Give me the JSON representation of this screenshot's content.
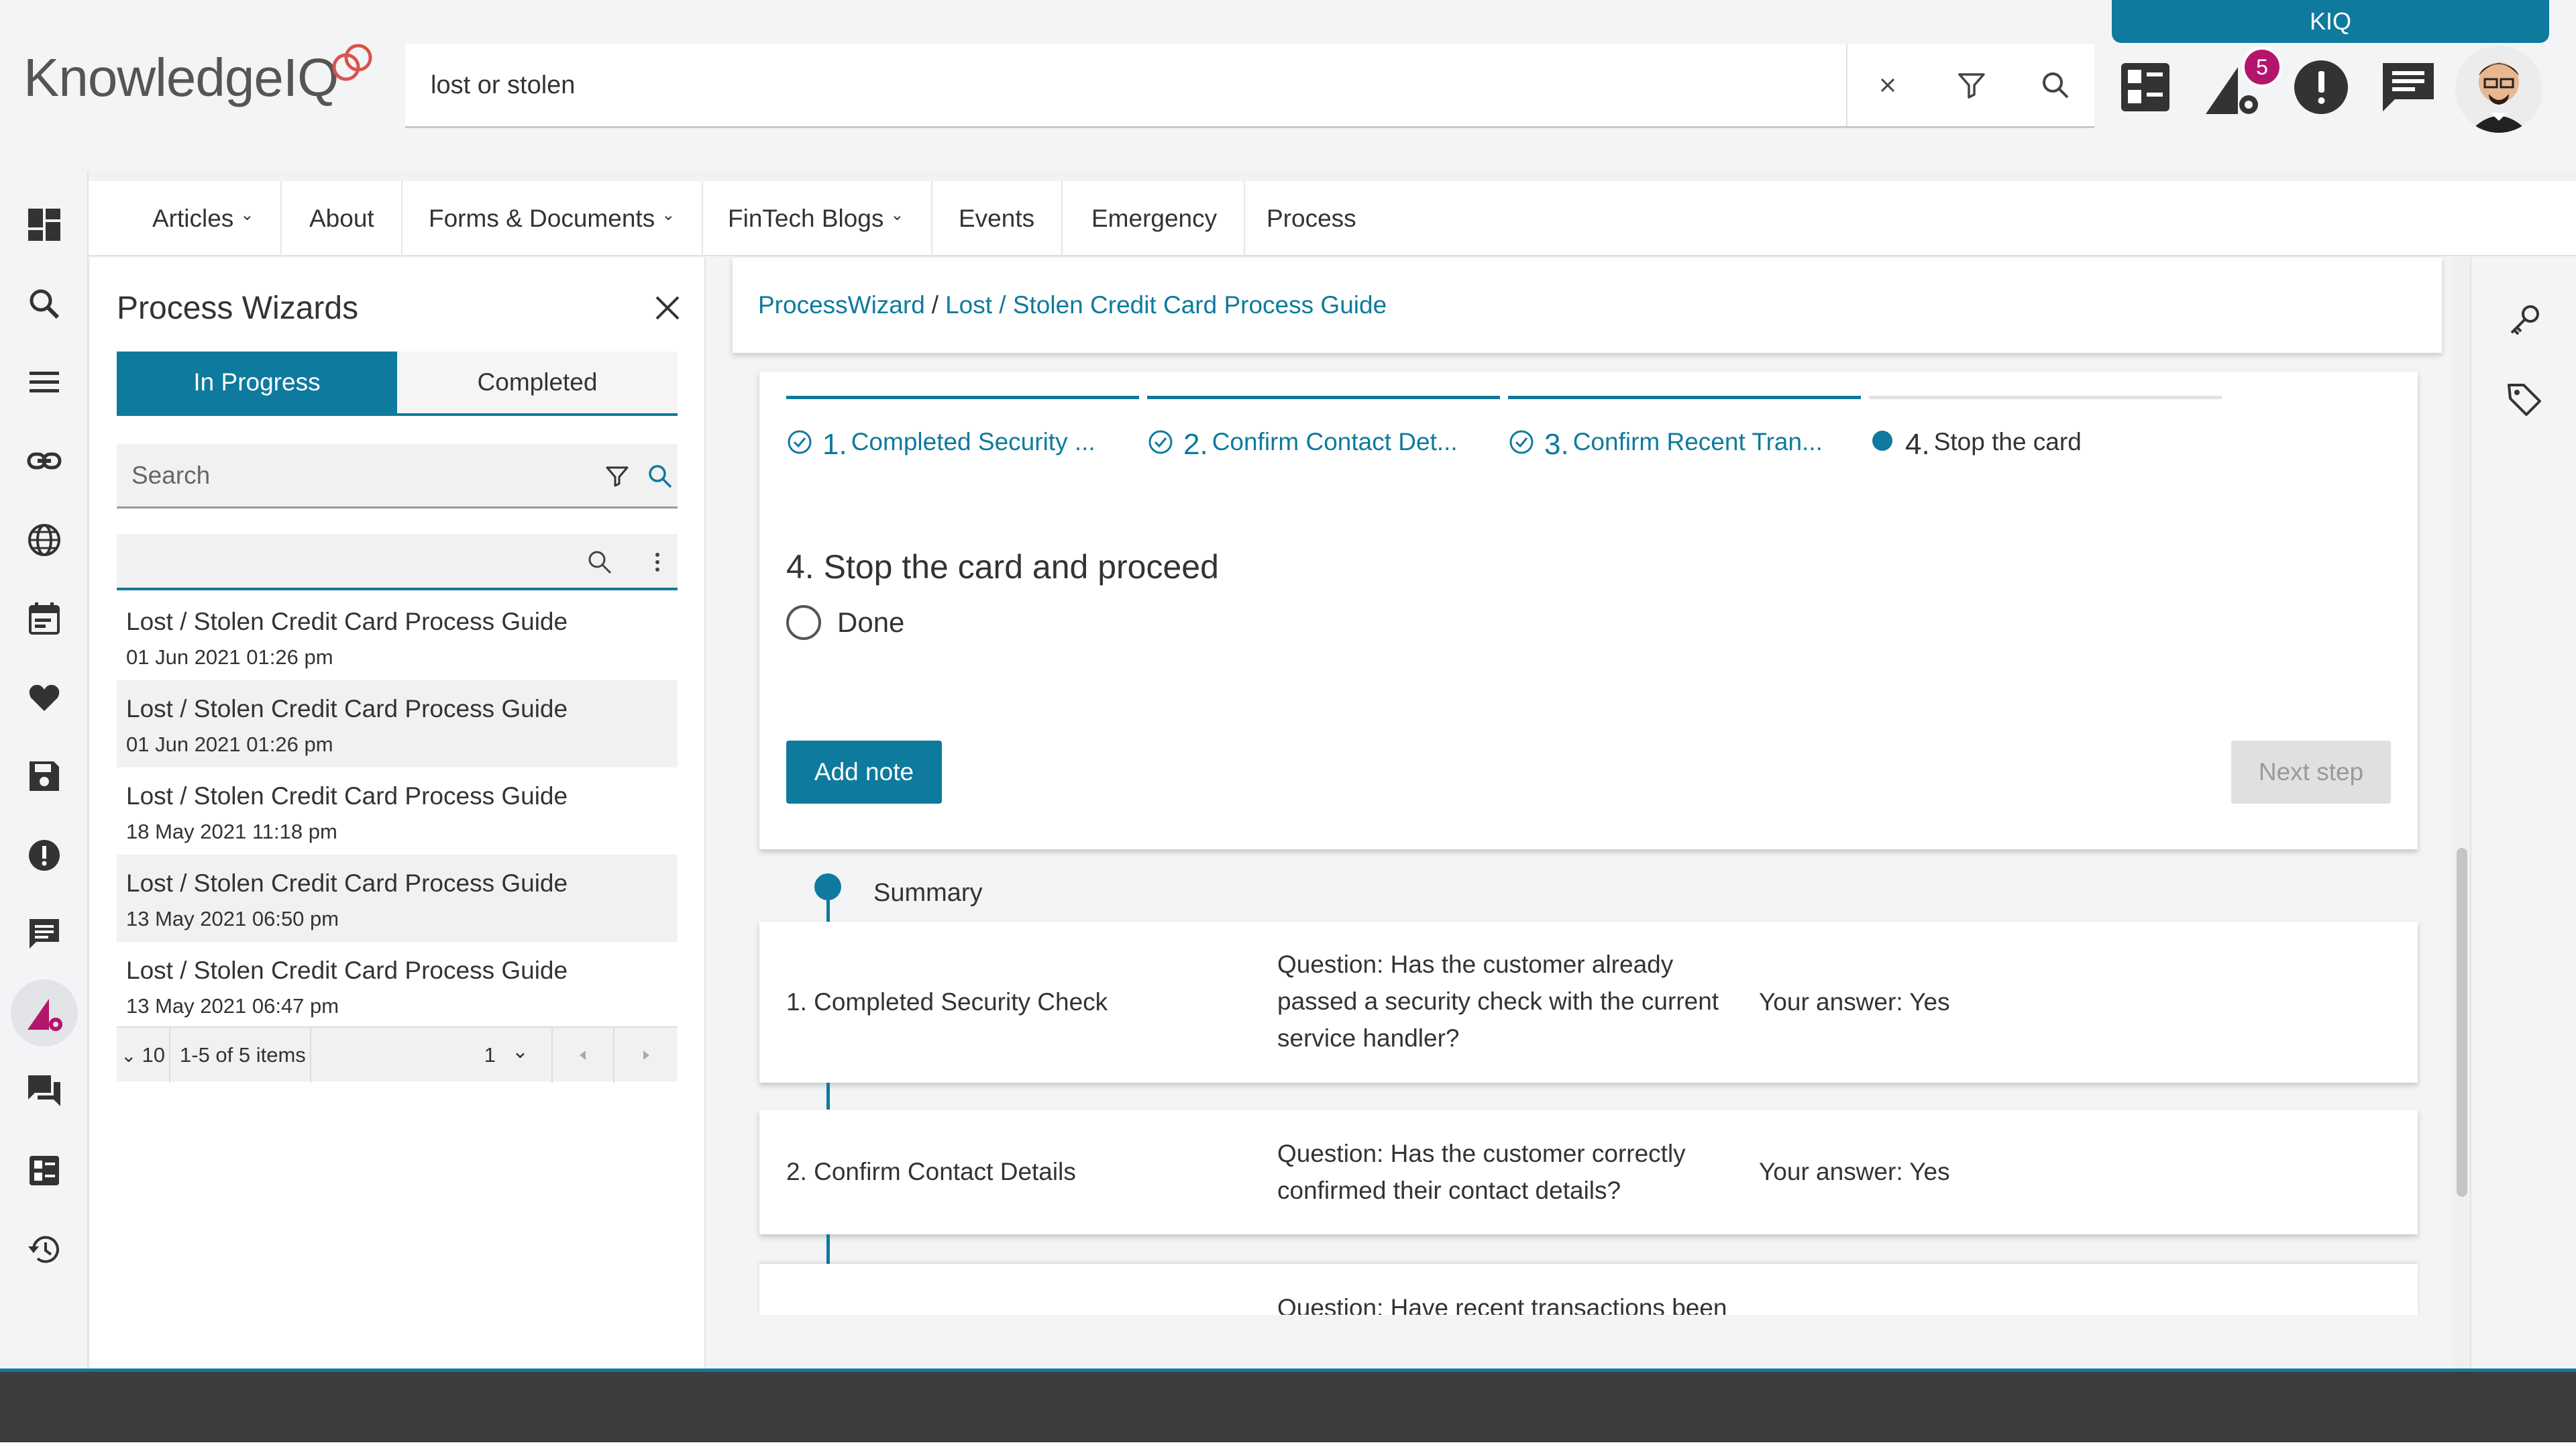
{
  "app": {
    "logo_text": "KnowledgeIQ",
    "kiq_tab": "KIQ",
    "notification_count": "5"
  },
  "search": {
    "value": "lost or stolen"
  },
  "nav": {
    "items": [
      {
        "label": "Articles",
        "dropdown": true
      },
      {
        "label": "About",
        "dropdown": false
      },
      {
        "label": "Forms & Documents",
        "dropdown": true
      },
      {
        "label": "FinTech Blogs",
        "dropdown": true
      },
      {
        "label": "Events",
        "dropdown": false
      },
      {
        "label": "Emergency",
        "dropdown": false
      },
      {
        "label": "Process",
        "dropdown": false
      }
    ]
  },
  "process_wizards": {
    "title": "Process Wizards",
    "tabs": [
      "In Progress",
      "Completed"
    ],
    "active_tab": "In Progress",
    "search_placeholder": "Search",
    "items": [
      {
        "title": "Lost / Stolen Credit Card Process Guide",
        "date": "01 Jun 2021 01:26 pm"
      },
      {
        "title": "Lost / Stolen Credit Card Process Guide",
        "date": "01 Jun 2021 01:26 pm"
      },
      {
        "title": "Lost / Stolen Credit Card Process Guide",
        "date": "18 May 2021 11:18 pm"
      },
      {
        "title": "Lost / Stolen Credit Card Process Guide",
        "date": "13 May 2021 06:50 pm"
      },
      {
        "title": "Lost / Stolen Credit Card Process Guide",
        "date": "13 May 2021 06:47 pm"
      }
    ],
    "pager": {
      "page_size": "10",
      "range": "1-5 of 5 items",
      "page": "1"
    }
  },
  "breadcrumb": {
    "root": "ProcessWizard",
    "separator": "/",
    "current": "Lost / Stolen Credit Card Process Guide"
  },
  "wizard": {
    "steps": [
      {
        "num": "1.",
        "label": "Completed Security ...",
        "status": "done"
      },
      {
        "num": "2.",
        "label": "Confirm Contact Det...",
        "status": "done"
      },
      {
        "num": "3.",
        "label": "Confirm Recent Tran...",
        "status": "done"
      },
      {
        "num": "4.",
        "label": "Stop the card",
        "status": "current"
      }
    ],
    "heading": "4. Stop the card and proceed",
    "option": "Done",
    "add_note": "Add note",
    "next_step": "Next step"
  },
  "summary": {
    "label": "Summary",
    "rows": [
      {
        "name": "1. Completed Security Check",
        "question": "Question: Has the customer already passed a security check with the current service handler?",
        "answer": "Your answer: Yes"
      },
      {
        "name": "2. Confirm Contact Details",
        "question": "Question: Has the customer correctly confirmed their contact details?",
        "answer": "Your answer: Yes"
      },
      {
        "name": "",
        "question": "Question: Have recent transactions been",
        "answer": ""
      }
    ]
  },
  "colors": {
    "accent": "#0e7a9e",
    "badge": "#b3156d",
    "logo_mark": "#d9534f"
  }
}
